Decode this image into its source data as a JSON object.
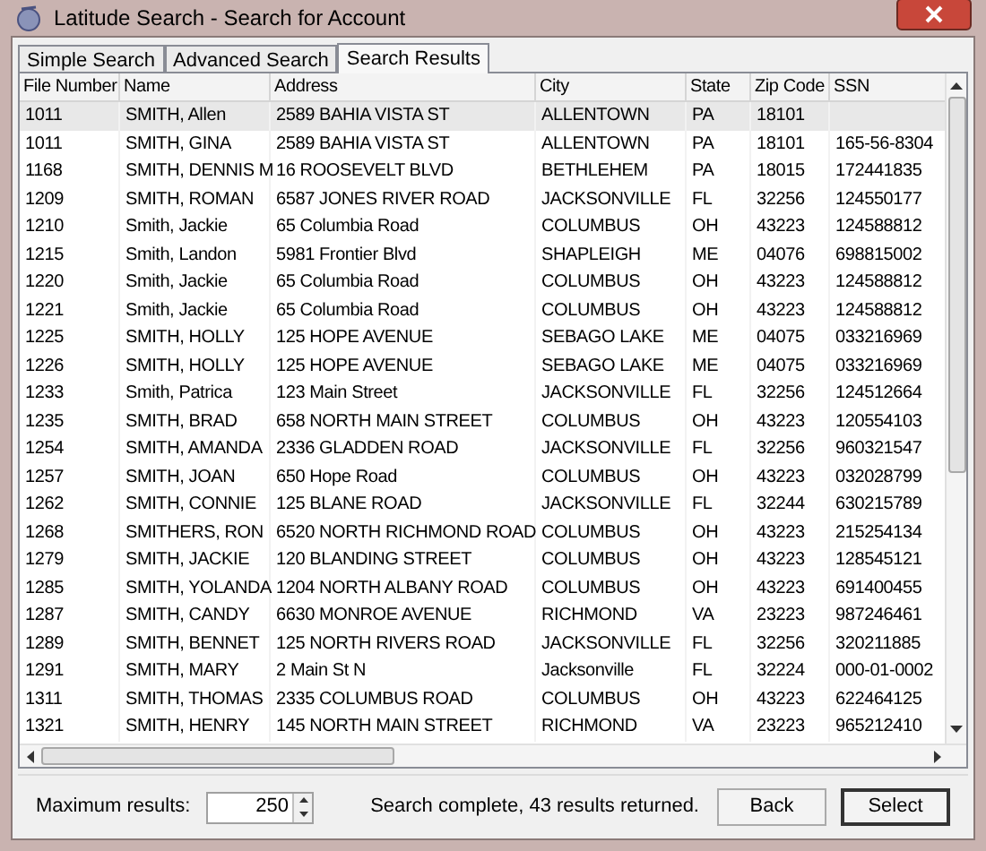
{
  "window": {
    "title": "Latitude Search - Search for Account"
  },
  "tabs": [
    {
      "label": "Simple Search",
      "selected": false
    },
    {
      "label": "Advanced Search",
      "selected": false
    },
    {
      "label": "Search Results",
      "selected": true
    }
  ],
  "table": {
    "columns": [
      "File Number",
      "Name",
      "Address",
      "City",
      "State",
      "Zip Code",
      "SSN"
    ],
    "rows": [
      {
        "selected": true,
        "cells": [
          "1011",
          "SMITH, Allen",
          "2589 BAHIA VISTA ST",
          "ALLENTOWN",
          "PA",
          "18101"
        ]
      },
      {
        "selected": false,
        "cells": [
          "1011",
          "SMITH, GINA",
          "2589 BAHIA VISTA ST",
          "ALLENTOWN",
          "PA",
          "18101",
          "165-56-8304"
        ]
      },
      {
        "selected": false,
        "cells": [
          "1168",
          "SMITH, DENNIS M",
          "16 ROOSEVELT BLVD",
          "BETHLEHEM",
          "PA",
          "18015",
          "172441835"
        ]
      },
      {
        "selected": false,
        "cells": [
          "1209",
          "SMITH, ROMAN",
          "6587 JONES RIVER ROAD",
          "JACKSONVILLE",
          "FL",
          "32256",
          "124550177"
        ]
      },
      {
        "selected": false,
        "cells": [
          "1210",
          "Smith, Jackie",
          "65 Columbia Road",
          "COLUMBUS",
          "OH",
          "43223",
          "124588812"
        ]
      },
      {
        "selected": false,
        "cells": [
          "1215",
          "Smith, Landon",
          "5981 Frontier Blvd",
          "SHAPLEIGH",
          "ME",
          "04076",
          "698815002"
        ]
      },
      {
        "selected": false,
        "cells": [
          "1220",
          "Smith, Jackie",
          "65 Columbia Road",
          "COLUMBUS",
          "OH",
          "43223",
          "124588812"
        ]
      },
      {
        "selected": false,
        "cells": [
          "1221",
          "Smith, Jackie",
          "65 Columbia Road",
          "COLUMBUS",
          "OH",
          "43223",
          "124588812"
        ]
      },
      {
        "selected": false,
        "cells": [
          "1225",
          "SMITH, HOLLY",
          "125 HOPE AVENUE",
          "SEBAGO LAKE",
          "ME",
          "04075",
          "033216969"
        ]
      },
      {
        "selected": false,
        "cells": [
          "1226",
          "SMITH, HOLLY",
          "125 HOPE AVENUE",
          "SEBAGO LAKE",
          "ME",
          "04075",
          "033216969"
        ]
      },
      {
        "selected": false,
        "cells": [
          "1233",
          "Smith, Patrica",
          "123 Main Street",
          "JACKSONVILLE",
          "FL",
          "32256",
          "124512664"
        ]
      },
      {
        "selected": false,
        "cells": [
          "1235",
          "SMITH, BRAD",
          "658 NORTH MAIN STREET",
          "COLUMBUS",
          "OH",
          "43223",
          "120554103"
        ]
      },
      {
        "selected": false,
        "cells": [
          "1254",
          "SMITH, AMANDA",
          "2336 GLADDEN ROAD",
          "JACKSONVILLE",
          "FL",
          "32256",
          "960321547"
        ]
      },
      {
        "selected": false,
        "cells": [
          "1257",
          "SMITH, JOAN",
          "650 Hope Road",
          "COLUMBUS",
          "OH",
          "43223",
          "032028799"
        ]
      },
      {
        "selected": false,
        "cells": [
          "1262",
          "SMITH, CONNIE",
          "125 BLANE ROAD",
          "JACKSONVILLE",
          "FL",
          "32244",
          "630215789"
        ]
      },
      {
        "selected": false,
        "cells": [
          "1268",
          "SMITHERS, RON",
          "6520 NORTH RICHMOND ROAD",
          "COLUMBUS",
          "OH",
          "43223",
          "215254134"
        ]
      },
      {
        "selected": false,
        "cells": [
          "1279",
          "SMITH, JACKIE",
          "120 BLANDING STREET",
          "COLUMBUS",
          "OH",
          "43223",
          "128545121"
        ]
      },
      {
        "selected": false,
        "cells": [
          "1285",
          "SMITH, YOLANDA",
          "1204 NORTH ALBANY ROAD",
          "COLUMBUS",
          "OH",
          "43223",
          "691400455"
        ]
      },
      {
        "selected": false,
        "cells": [
          "1287",
          "SMITH, CANDY",
          "6630 MONROE AVENUE",
          "RICHMOND",
          "VA",
          "23223",
          "987246461"
        ]
      },
      {
        "selected": false,
        "cells": [
          "1289",
          "SMITH, BENNET",
          "125 NORTH RIVERS ROAD",
          "JACKSONVILLE",
          "FL",
          "32256",
          "320211885"
        ]
      },
      {
        "selected": false,
        "cells": [
          "1291",
          "SMITH, MARY",
          "2 Main St N",
          "Jacksonville",
          "FL",
          "32224",
          "000-01-0002"
        ]
      },
      {
        "selected": false,
        "cells": [
          "1311",
          "SMITH, THOMAS",
          "2335 COLUMBUS ROAD",
          "COLUMBUS",
          "OH",
          "43223",
          "622464125"
        ]
      },
      {
        "selected": false,
        "cells": [
          "1321",
          "SMITH, HENRY",
          "145 NORTH MAIN STREET",
          "RICHMOND",
          "VA",
          "23223",
          "965212410"
        ]
      }
    ]
  },
  "footer": {
    "max_label": "Maximum results:",
    "max_value": "250",
    "status": "Search complete, 43 results returned.",
    "buttons": [
      "Back",
      "Select"
    ]
  }
}
